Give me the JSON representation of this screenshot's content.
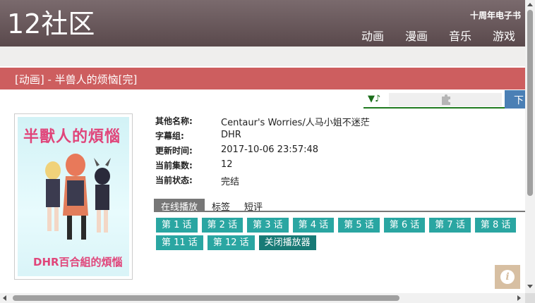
{
  "site": {
    "logo": "12社区",
    "ebook_link": "十周年电子书"
  },
  "nav": [
    "动画",
    "漫画",
    "音乐",
    "游戏"
  ],
  "page_title": "[动画] - 半兽人的烦恼[完]",
  "player": {
    "music_icon": "▼♪",
    "download_label": "下"
  },
  "cover": {
    "title": "半獸人的煩惱",
    "subtitle": "DHR百合組的煩惱"
  },
  "info": [
    {
      "label": "其他名称:",
      "value": "Centaur's Worries/人马小姐不迷茫"
    },
    {
      "label": "字幕组:",
      "value": "DHR"
    },
    {
      "label": "更新时间:",
      "value": "2017-10-06 23:57:48"
    },
    {
      "label": "当前集数:",
      "value": "12"
    },
    {
      "label": "当前状态:",
      "value": "完结"
    }
  ],
  "tabs": [
    "在线播放",
    "标签",
    "短评"
  ],
  "episodes_row1": [
    "第 1 话",
    "第 2 话",
    "第 3 话",
    "第 4 话",
    "第 5 话",
    "第 6 话",
    "第 7 话",
    "第 8 话"
  ],
  "episodes_row2": [
    "第 11 话",
    "第 12 话"
  ],
  "close_player": "关闭播放器",
  "colors": {
    "header": "#6b5a5d",
    "title_bar": "#cd5e5f",
    "episode_button": "#2aa6a2",
    "close_button": "#187a76"
  }
}
